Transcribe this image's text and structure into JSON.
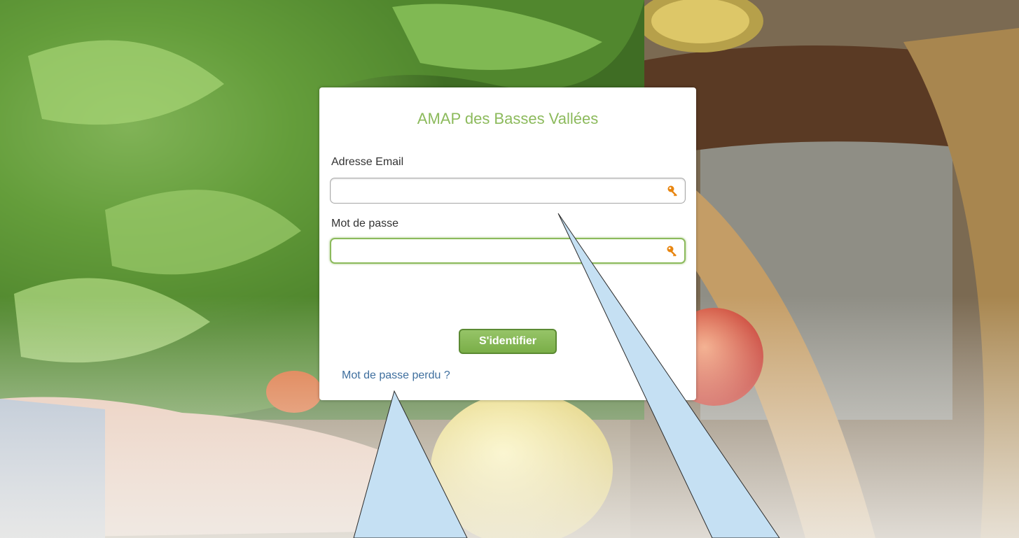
{
  "app": {
    "title": "AMAP des Basses Vallées"
  },
  "form": {
    "email_label": "Adresse Email",
    "email_value": "",
    "email_placeholder": "",
    "password_label": "Mot de passe",
    "password_value": "",
    "password_placeholder": "",
    "submit_label": "S'identifier",
    "forgot_password_label": "Mot de passe perdu ?"
  },
  "icons": {
    "input_key_icon": "key-icon",
    "background": "vegetable-basket-photo"
  },
  "colors": {
    "brand_green": "#8cba5c",
    "button_border": "#5b8a33",
    "link_blue": "#3f6f9e",
    "key_orange": "#e8850f",
    "callout_fill": "#c5e0f3"
  }
}
